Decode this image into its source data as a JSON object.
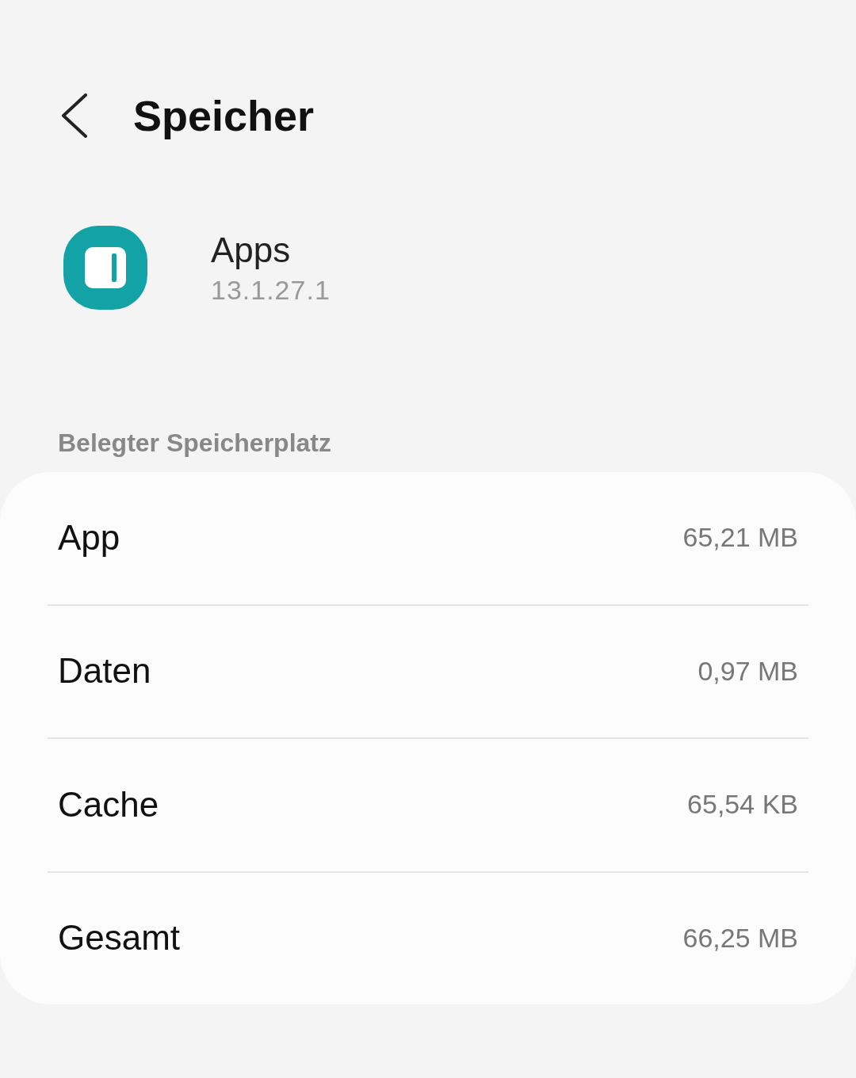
{
  "header": {
    "title": "Speicher"
  },
  "app": {
    "name": "Apps",
    "version": "13.1.27.1"
  },
  "section": {
    "title": "Belegter Speicherplatz"
  },
  "rows": [
    {
      "label": "App",
      "value": "65,21 MB"
    },
    {
      "label": "Daten",
      "value": "0,97 MB"
    },
    {
      "label": "Cache",
      "value": "65,54 KB"
    },
    {
      "label": "Gesamt",
      "value": "66,25 MB"
    }
  ]
}
